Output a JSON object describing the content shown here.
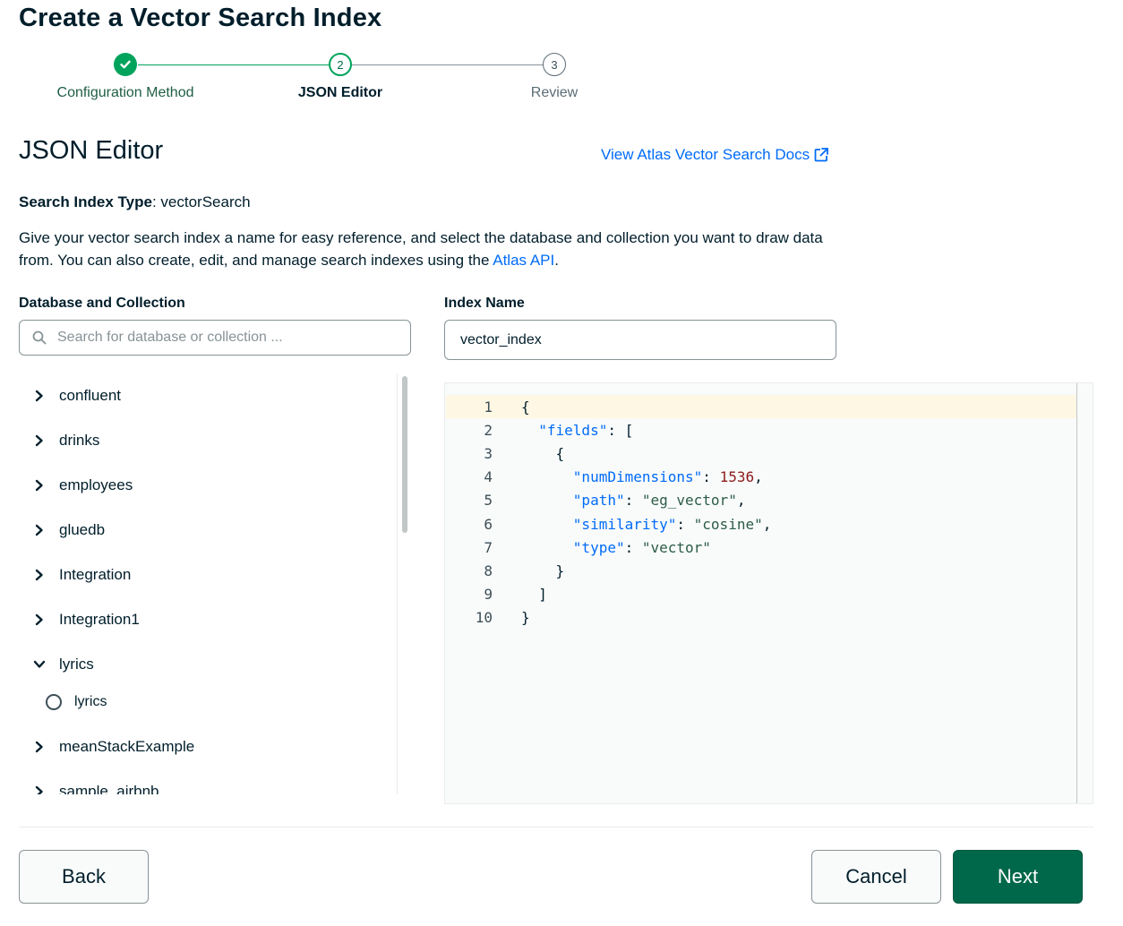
{
  "page_title": "Create a Vector Search Index",
  "stepper": {
    "steps": [
      {
        "label": "Configuration Method",
        "number": "1",
        "state": "complete"
      },
      {
        "label": "JSON Editor",
        "number": "2",
        "state": "current"
      },
      {
        "label": "Review",
        "number": "3",
        "state": "upcoming"
      }
    ]
  },
  "section_title": "JSON Editor",
  "docs_link": "View Atlas Vector Search Docs",
  "index_type": {
    "label": "Search Index Type",
    "value": "vectorSearch"
  },
  "description": {
    "text_before": "Give your vector search index a name for easy reference, and select the database and collection you want to draw data from. You can also create, edit, and manage search indexes using the ",
    "link": "Atlas API",
    "text_after": "."
  },
  "db_collection": {
    "label": "Database and Collection",
    "search_placeholder": "Search for database or collection ...",
    "items": [
      {
        "name": "confluent",
        "expanded": false
      },
      {
        "name": "drinks",
        "expanded": false
      },
      {
        "name": "employees",
        "expanded": false
      },
      {
        "name": "gluedb",
        "expanded": false
      },
      {
        "name": "Integration",
        "expanded": false
      },
      {
        "name": "Integration1",
        "expanded": false
      },
      {
        "name": "lyrics",
        "expanded": true,
        "collections": [
          "lyrics"
        ]
      },
      {
        "name": "meanStackExample",
        "expanded": false
      },
      {
        "name": "sample_airbnb",
        "expanded": false
      }
    ]
  },
  "index_name": {
    "label": "Index Name",
    "value": "vector_index"
  },
  "editor": {
    "line_numbers": [
      "1",
      "2",
      "3",
      "4",
      "5",
      "6",
      "7",
      "8",
      "9",
      "10"
    ],
    "code_lines": [
      "{",
      "  \"fields\": [",
      "    {",
      "      \"numDimensions\": 1536,",
      "      \"path\": \"eg_vector\",",
      "      \"similarity\": \"cosine\",",
      "      \"type\": \"vector\"",
      "    }",
      "  ]",
      "}"
    ]
  },
  "buttons": {
    "back": "Back",
    "cancel": "Cancel",
    "next": "Next"
  },
  "colors": {
    "accent_green": "#00684a",
    "link_blue": "#016bf8",
    "step_complete": "#00a35c"
  }
}
